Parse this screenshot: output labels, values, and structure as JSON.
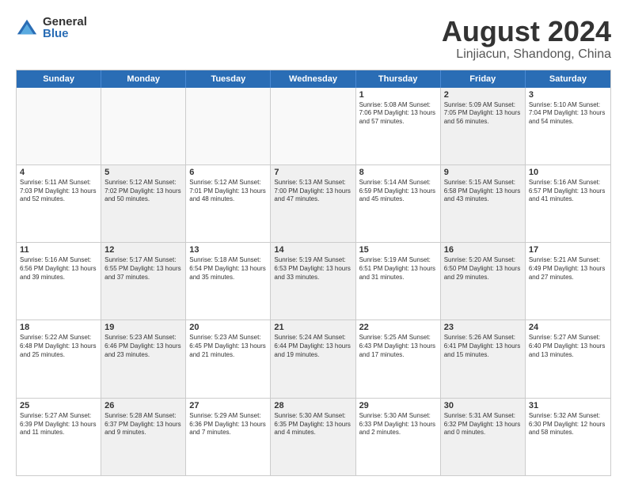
{
  "logo": {
    "general": "General",
    "blue": "Blue"
  },
  "title": "August 2024",
  "subtitle": "Linjiacun, Shandong, China",
  "weekdays": [
    "Sunday",
    "Monday",
    "Tuesday",
    "Wednesday",
    "Thursday",
    "Friday",
    "Saturday"
  ],
  "weeks": [
    [
      {
        "day": "",
        "info": "",
        "empty": true
      },
      {
        "day": "",
        "info": "",
        "empty": true
      },
      {
        "day": "",
        "info": "",
        "empty": true
      },
      {
        "day": "",
        "info": "",
        "empty": true
      },
      {
        "day": "1",
        "info": "Sunrise: 5:08 AM\nSunset: 7:06 PM\nDaylight: 13 hours\nand 57 minutes."
      },
      {
        "day": "2",
        "info": "Sunrise: 5:09 AM\nSunset: 7:05 PM\nDaylight: 13 hours\nand 56 minutes.",
        "shaded": true
      },
      {
        "day": "3",
        "info": "Sunrise: 5:10 AM\nSunset: 7:04 PM\nDaylight: 13 hours\nand 54 minutes."
      }
    ],
    [
      {
        "day": "4",
        "info": "Sunrise: 5:11 AM\nSunset: 7:03 PM\nDaylight: 13 hours\nand 52 minutes."
      },
      {
        "day": "5",
        "info": "Sunrise: 5:12 AM\nSunset: 7:02 PM\nDaylight: 13 hours\nand 50 minutes.",
        "shaded": true
      },
      {
        "day": "6",
        "info": "Sunrise: 5:12 AM\nSunset: 7:01 PM\nDaylight: 13 hours\nand 48 minutes."
      },
      {
        "day": "7",
        "info": "Sunrise: 5:13 AM\nSunset: 7:00 PM\nDaylight: 13 hours\nand 47 minutes.",
        "shaded": true
      },
      {
        "day": "8",
        "info": "Sunrise: 5:14 AM\nSunset: 6:59 PM\nDaylight: 13 hours\nand 45 minutes."
      },
      {
        "day": "9",
        "info": "Sunrise: 5:15 AM\nSunset: 6:58 PM\nDaylight: 13 hours\nand 43 minutes.",
        "shaded": true
      },
      {
        "day": "10",
        "info": "Sunrise: 5:16 AM\nSunset: 6:57 PM\nDaylight: 13 hours\nand 41 minutes."
      }
    ],
    [
      {
        "day": "11",
        "info": "Sunrise: 5:16 AM\nSunset: 6:56 PM\nDaylight: 13 hours\nand 39 minutes."
      },
      {
        "day": "12",
        "info": "Sunrise: 5:17 AM\nSunset: 6:55 PM\nDaylight: 13 hours\nand 37 minutes.",
        "shaded": true
      },
      {
        "day": "13",
        "info": "Sunrise: 5:18 AM\nSunset: 6:54 PM\nDaylight: 13 hours\nand 35 minutes."
      },
      {
        "day": "14",
        "info": "Sunrise: 5:19 AM\nSunset: 6:53 PM\nDaylight: 13 hours\nand 33 minutes.",
        "shaded": true
      },
      {
        "day": "15",
        "info": "Sunrise: 5:19 AM\nSunset: 6:51 PM\nDaylight: 13 hours\nand 31 minutes."
      },
      {
        "day": "16",
        "info": "Sunrise: 5:20 AM\nSunset: 6:50 PM\nDaylight: 13 hours\nand 29 minutes.",
        "shaded": true
      },
      {
        "day": "17",
        "info": "Sunrise: 5:21 AM\nSunset: 6:49 PM\nDaylight: 13 hours\nand 27 minutes."
      }
    ],
    [
      {
        "day": "18",
        "info": "Sunrise: 5:22 AM\nSunset: 6:48 PM\nDaylight: 13 hours\nand 25 minutes."
      },
      {
        "day": "19",
        "info": "Sunrise: 5:23 AM\nSunset: 6:46 PM\nDaylight: 13 hours\nand 23 minutes.",
        "shaded": true
      },
      {
        "day": "20",
        "info": "Sunrise: 5:23 AM\nSunset: 6:45 PM\nDaylight: 13 hours\nand 21 minutes."
      },
      {
        "day": "21",
        "info": "Sunrise: 5:24 AM\nSunset: 6:44 PM\nDaylight: 13 hours\nand 19 minutes.",
        "shaded": true
      },
      {
        "day": "22",
        "info": "Sunrise: 5:25 AM\nSunset: 6:43 PM\nDaylight: 13 hours\nand 17 minutes."
      },
      {
        "day": "23",
        "info": "Sunrise: 5:26 AM\nSunset: 6:41 PM\nDaylight: 13 hours\nand 15 minutes.",
        "shaded": true
      },
      {
        "day": "24",
        "info": "Sunrise: 5:27 AM\nSunset: 6:40 PM\nDaylight: 13 hours\nand 13 minutes."
      }
    ],
    [
      {
        "day": "25",
        "info": "Sunrise: 5:27 AM\nSunset: 6:39 PM\nDaylight: 13 hours\nand 11 minutes."
      },
      {
        "day": "26",
        "info": "Sunrise: 5:28 AM\nSunset: 6:37 PM\nDaylight: 13 hours\nand 9 minutes.",
        "shaded": true
      },
      {
        "day": "27",
        "info": "Sunrise: 5:29 AM\nSunset: 6:36 PM\nDaylight: 13 hours\nand 7 minutes."
      },
      {
        "day": "28",
        "info": "Sunrise: 5:30 AM\nSunset: 6:35 PM\nDaylight: 13 hours\nand 4 minutes.",
        "shaded": true
      },
      {
        "day": "29",
        "info": "Sunrise: 5:30 AM\nSunset: 6:33 PM\nDaylight: 13 hours\nand 2 minutes."
      },
      {
        "day": "30",
        "info": "Sunrise: 5:31 AM\nSunset: 6:32 PM\nDaylight: 13 hours\nand 0 minutes.",
        "shaded": true
      },
      {
        "day": "31",
        "info": "Sunrise: 5:32 AM\nSunset: 6:30 PM\nDaylight: 12 hours\nand 58 minutes."
      }
    ]
  ]
}
